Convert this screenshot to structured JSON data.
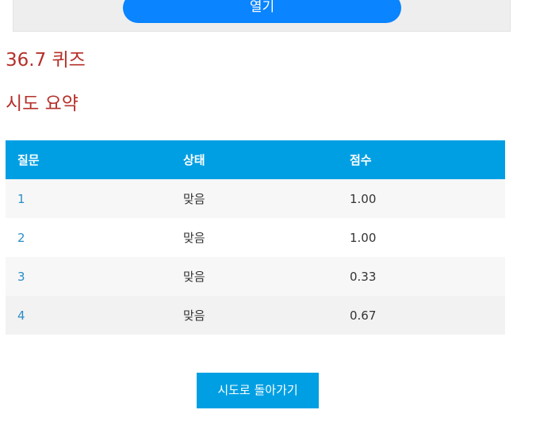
{
  "top_panel": {
    "open_button_label": "열기"
  },
  "quiz": {
    "title": "36.7 퀴즈"
  },
  "summary": {
    "heading": "시도 요약",
    "columns": {
      "question": "질문",
      "status": "상태",
      "points": "점수"
    },
    "rows": [
      {
        "question": "1",
        "status": "맞음",
        "points": "1.00"
      },
      {
        "question": "2",
        "status": "맞음",
        "points": "1.00"
      },
      {
        "question": "3",
        "status": "맞음",
        "points": "0.33"
      },
      {
        "question": "4",
        "status": "맞음",
        "points": "0.67"
      }
    ]
  },
  "actions": {
    "back_button_label": "시도로 돌아가기"
  },
  "colors": {
    "primary_blue": "#009fe3",
    "open_button_blue": "#0a84ff",
    "heading_red": "#b5302a",
    "link_blue": "#2a8ec8"
  }
}
